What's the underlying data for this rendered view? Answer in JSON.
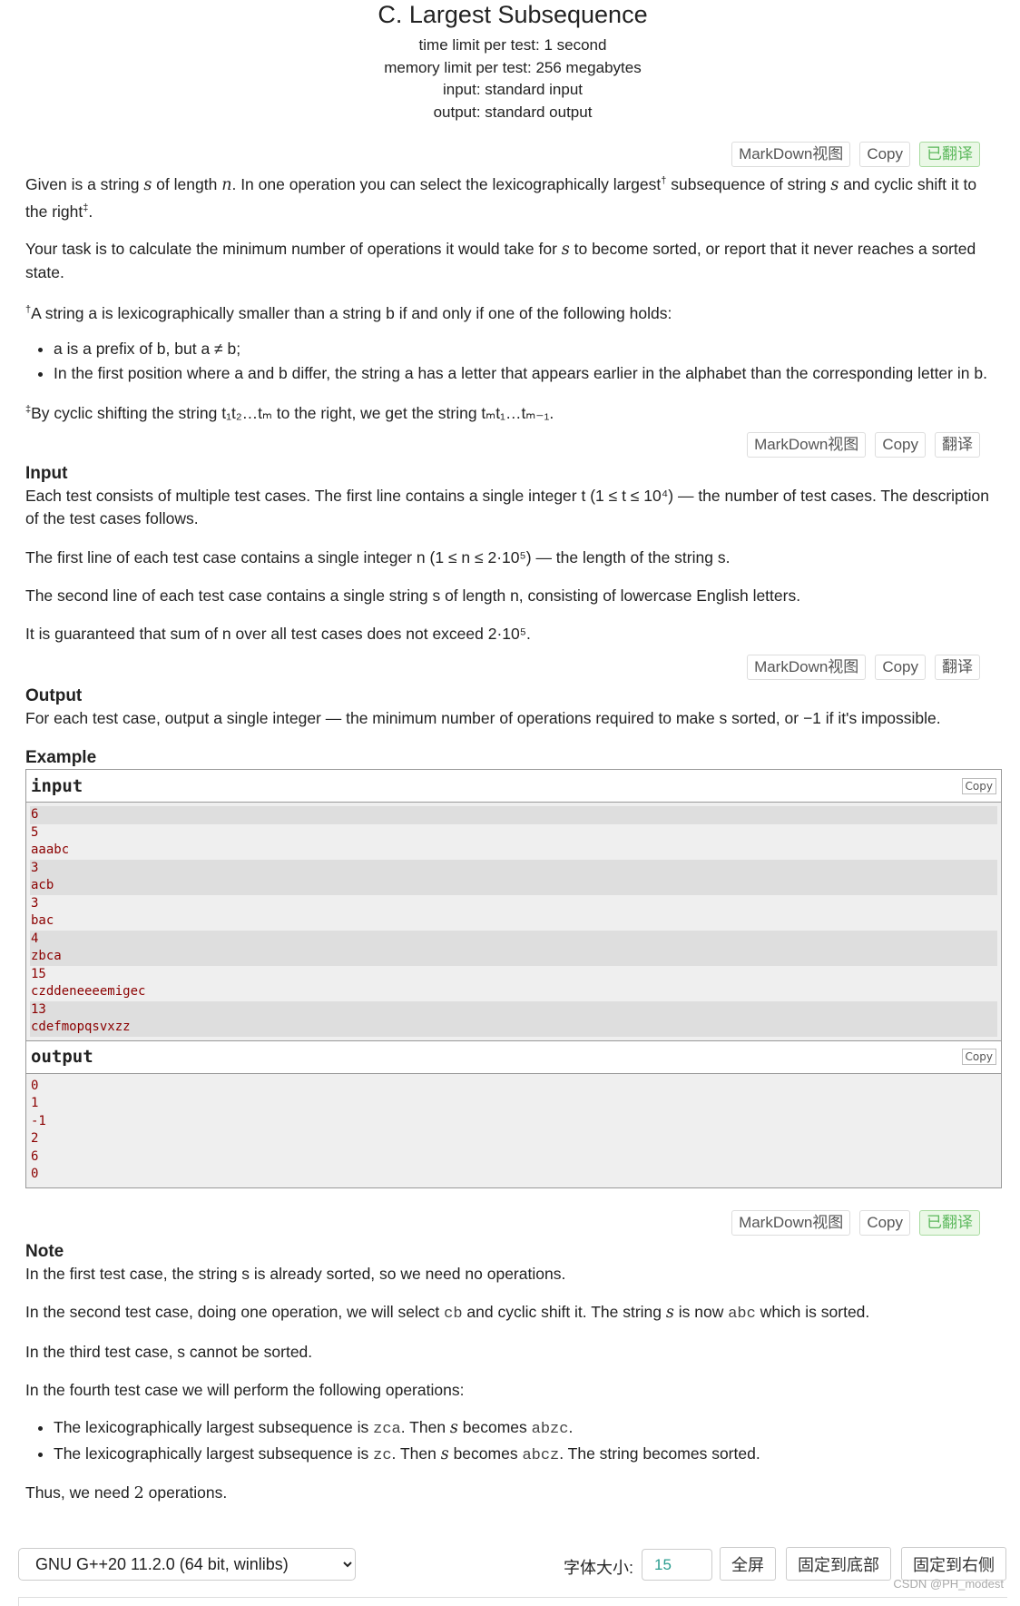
{
  "header": {
    "title": "C. Largest Subsequence",
    "time_limit": "time limit per test: 1 second",
    "memory_limit": "memory limit per test: 256 megabytes",
    "input": "input: standard input",
    "output": "output: standard output"
  },
  "buttons": {
    "markdown": "MarkDown视图",
    "copy": "Copy",
    "translated": "已翻译",
    "translate": "翻译"
  },
  "statement": {
    "p1_a": "Given is a string ",
    "p1_b": " of length ",
    "p1_c": ". In one operation you can select the lexicographically largest",
    "p1_d": " subsequence of string ",
    "p1_e": " and cyclic shift it to the right",
    "p1_f": ".",
    "p2_a": "Your task is to calculate the minimum number of operations it would take for ",
    "p2_b": " to become sorted, or report that it never reaches a sorted state.",
    "fn1": "A string a is lexicographically smaller than a string b if and only if one of the following holds:",
    "li1": "a is a prefix of b, but a ≠ b;",
    "li2": "In the first position where a and b differ, the string a has a letter that appears earlier in the alphabet than the corresponding letter in b.",
    "fn2": "By cyclic shifting the string t₁t₂…tₘ to the right, we get the string tₘt₁…tₘ₋₁."
  },
  "input_section": {
    "title": "Input",
    "p1": "Each test consists of multiple test cases. The first line contains a single integer t (1 ≤ t ≤ 10⁴) — the number of test cases. The description of the test cases follows.",
    "p2": "The first line of each test case contains a single integer n (1 ≤ n ≤ 2·10⁵) — the length of the string s.",
    "p3": "The second line of each test case contains a single string s of length n, consisting of lowercase English letters.",
    "p4": "It is guaranteed that sum of n over all test cases does not exceed 2·10⁵."
  },
  "output_section": {
    "title": "Output",
    "p1": "For each test case, output a single integer — the minimum number of operations required to make s sorted, or −1 if it's impossible."
  },
  "example": {
    "title": "Example",
    "input_label": "input",
    "output_label": "output",
    "copy": "Copy",
    "input_lines": [
      "6",
      "5",
      "aaabc",
      "3",
      "acb",
      "3",
      "bac",
      "4",
      "zbca",
      "15",
      "czddeneeeemigec",
      "13",
      "cdefmopqsvxzz"
    ],
    "input_shade": [
      true,
      false,
      false,
      true,
      true,
      false,
      false,
      true,
      true,
      false,
      false,
      true,
      true
    ],
    "output_lines": [
      "0",
      "1",
      "-1",
      "2",
      "6",
      "0"
    ]
  },
  "note": {
    "title": "Note",
    "p1": "In the first test case, the string s is already sorted, so we need no operations.",
    "p2_a": "In the second test case, doing one operation, we will select ",
    "p2_code1": "cb",
    "p2_b": " and cyclic shift it. The string ",
    "p2_c": " is now ",
    "p2_code2": "abc",
    "p2_d": " which is sorted.",
    "p3": "In the third test case, s cannot be sorted.",
    "p4": "In the fourth test case we will perform the following operations:",
    "li1_a": "The lexicographically largest subsequence is ",
    "li1_code1": "zca",
    "li1_b": ". Then ",
    "li1_c": " becomes ",
    "li1_code2": "abzc",
    "li1_d": ".",
    "li2_a": "The lexicographically largest subsequence is ",
    "li2_code1": "zc",
    "li2_b": ". Then ",
    "li2_c": " becomes ",
    "li2_code2": "abcz",
    "li2_d": ". The string becomes sorted.",
    "p5_a": "Thus, we need ",
    "p5_num": "2",
    "p5_b": " operations."
  },
  "vars": {
    "s": "s",
    "n": "n",
    "dagger": "†",
    "ddagger": "‡"
  },
  "footer": {
    "compiler": "GNU G++20 11.2.0 (64 bit, winlibs)",
    "font_size_label": "字体大小:",
    "font_size_value": "15",
    "fullscreen": "全屏",
    "pin_bottom": "固定到底部",
    "pin_right": "固定到右侧",
    "watermark": "CSDN @PH_modest"
  }
}
